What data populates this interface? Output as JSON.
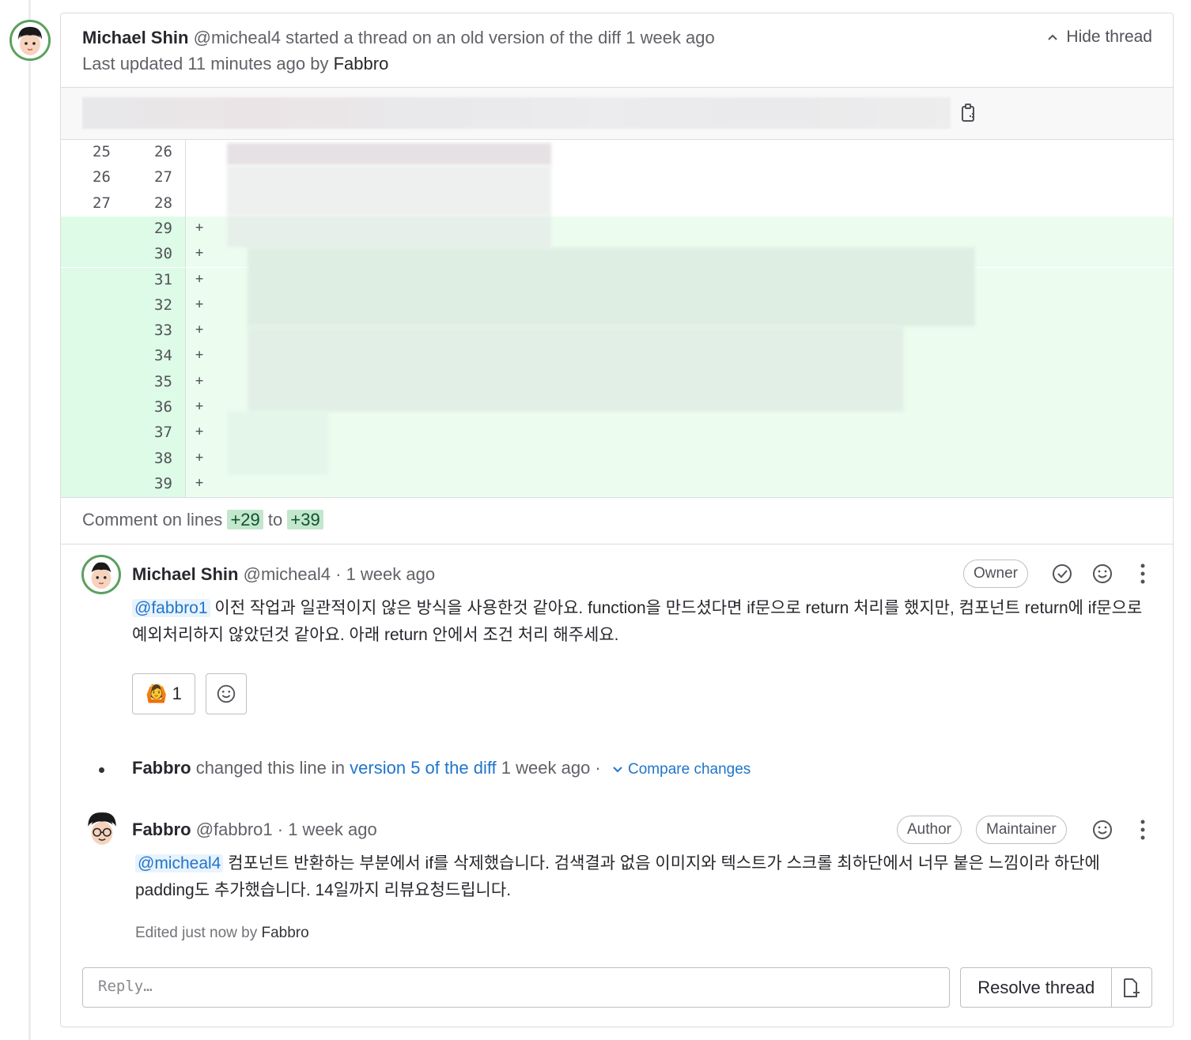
{
  "thread": {
    "author_name": "Michael Shin",
    "author_handle": "@micheal4",
    "started_text": "started a thread on an old version of the diff",
    "started_time": "1 week ago",
    "last_updated_text": "Last updated 11 minutes ago by",
    "last_updated_by": "Fabbro",
    "hide_label": "Hide thread"
  },
  "diff": {
    "rows": [
      {
        "old": "25",
        "new": "26",
        "sign": ""
      },
      {
        "old": "26",
        "new": "27",
        "sign": ""
      },
      {
        "old": "27",
        "new": "28",
        "sign": ""
      },
      {
        "old": "",
        "new": "29",
        "sign": "+"
      },
      {
        "old": "",
        "new": "30",
        "sign": "+"
      },
      {
        "old": "",
        "new": "31",
        "sign": "+"
      },
      {
        "old": "",
        "new": "32",
        "sign": "+"
      },
      {
        "old": "",
        "new": "33",
        "sign": "+"
      },
      {
        "old": "",
        "new": "34",
        "sign": "+"
      },
      {
        "old": "",
        "new": "35",
        "sign": "+"
      },
      {
        "old": "",
        "new": "36",
        "sign": "+"
      },
      {
        "old": "",
        "new": "37",
        "sign": "+"
      },
      {
        "old": "",
        "new": "38",
        "sign": "+"
      },
      {
        "old": "",
        "new": "39",
        "sign": "+"
      }
    ]
  },
  "comment_lines": {
    "prefix": "Comment on lines",
    "from": "+29",
    "to_word": "to",
    "to": "+39"
  },
  "note1": {
    "author_name": "Michael Shin",
    "author_handle": "@micheal4",
    "time": "· 1 week ago",
    "badge": "Owner",
    "mention": "@fabbro1",
    "body": "이전 작업과 일관적이지 않은 방식을 사용한것 같아요. function을 만드셨다면 if문으로 return 처리를 했지만, 컴포넌트 return에 if문으로 예외처리하지 않았던것 같아요. 아래 return 안에서 조건 처리 해주세요.",
    "reaction_emoji": "🙆",
    "reaction_count": "1"
  },
  "system_note": {
    "actor": "Fabbro",
    "text": "changed this line in",
    "link": "version 5 of the diff",
    "time": "1 week ago ·",
    "compare": "Compare changes"
  },
  "note2": {
    "author_name": "Fabbro",
    "author_handle": "@fabbro1",
    "time": "· 1 week ago",
    "badge_author": "Author",
    "badge_role": "Maintainer",
    "mention": "@micheal4",
    "body": "컴포넌트 반환하는 부분에서 if를 삭제했습니다. 검색결과 없음 이미지와 텍스트가 스크롤 최하단에서 너무 붙은 느낌이라 하단에 padding도 추가했습니다. 14일까지 리뷰요청드립니다.",
    "edited_text": "Edited just now by",
    "edited_by": "Fabbro"
  },
  "reply": {
    "placeholder": "Reply…",
    "resolve_label": "Resolve thread"
  },
  "colors": {
    "added_bg": "#ecfdf0",
    "added_gutter": "#ddfbe6",
    "link": "#1f75cb",
    "avatar_ring": "#5ba05f"
  }
}
